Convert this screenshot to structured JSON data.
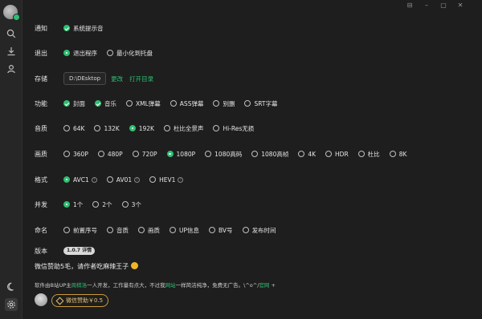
{
  "window": {
    "controls": [
      "⊟",
      "–",
      "▢",
      "✕"
    ]
  },
  "sidebar": {
    "icons": [
      "search-icon",
      "download-icon",
      "user-icon",
      "moon-icon",
      "settings-icon"
    ]
  },
  "settings": {
    "notify": {
      "label": "通知",
      "options": [
        {
          "text": "系统提示音",
          "checked": true
        }
      ]
    },
    "exit": {
      "label": "退出",
      "options": [
        {
          "text": "退出程序",
          "checked": true
        },
        {
          "text": "最小化到托盘",
          "checked": false
        }
      ]
    },
    "storage": {
      "label": "存储",
      "path": "D:\\DEsktop",
      "change": "更改",
      "open_dir": "打开目录"
    },
    "features": {
      "label": "功能",
      "options": [
        {
          "text": "封面",
          "checked": true
        },
        {
          "text": "音乐",
          "checked": true
        },
        {
          "text": "XML弹幕",
          "checked": false
        },
        {
          "text": "ASS弹幕",
          "checked": false
        },
        {
          "text": "别删",
          "checked": false
        },
        {
          "text": "SRT字幕",
          "checked": false
        }
      ]
    },
    "audio": {
      "label": "音质",
      "options": [
        {
          "text": "64K",
          "checked": false
        },
        {
          "text": "132K",
          "checked": false
        },
        {
          "text": "192K",
          "checked": true
        },
        {
          "text": "杜比全景声",
          "checked": false
        },
        {
          "text": "Hi-Res无损",
          "checked": false
        }
      ]
    },
    "quality": {
      "label": "画质",
      "options": [
        {
          "text": "360P",
          "checked": false
        },
        {
          "text": "480P",
          "checked": false
        },
        {
          "text": "720P",
          "checked": false
        },
        {
          "text": "1080P",
          "checked": true
        },
        {
          "text": "1080高码",
          "checked": false
        },
        {
          "text": "1080高帧",
          "checked": false
        },
        {
          "text": "4K",
          "checked": false
        },
        {
          "text": "HDR",
          "checked": false
        },
        {
          "text": "杜比",
          "checked": false
        },
        {
          "text": "8K",
          "checked": false
        }
      ]
    },
    "format": {
      "label": "格式",
      "options": [
        {
          "text": "AVC1",
          "checked": true,
          "info": "i"
        },
        {
          "text": "AV01",
          "checked": false,
          "info": "i"
        },
        {
          "text": "HEV1",
          "checked": false,
          "info": "i"
        }
      ]
    },
    "concurrency": {
      "label": "并发",
      "options": [
        {
          "text": "1个",
          "checked": true
        },
        {
          "text": "2个",
          "checked": false
        },
        {
          "text": "3个",
          "checked": false
        }
      ]
    },
    "naming": {
      "label": "命名",
      "options": [
        {
          "text": "前置序号",
          "checked": false
        },
        {
          "text": "音质",
          "checked": false
        },
        {
          "text": "画质",
          "checked": false
        },
        {
          "text": "UP信息",
          "checked": false
        },
        {
          "text": "BV号",
          "checked": false
        },
        {
          "text": "发布时间",
          "checked": false
        }
      ]
    },
    "version": {
      "label": "版本",
      "value": "1.0.7 详情"
    }
  },
  "donate": {
    "title": "微信赞助5毛，请作者吃麻辣王子",
    "desc_prefix": "软件由B站UP主",
    "desc_name": "周棋洛",
    "desc_mid": "一人开发，工作量有点大，不过我",
    "desc_link1": "网站",
    "desc_suffix": "一样简洁纯净，免费无广告。\\^o^/",
    "desc_link2": "官网",
    "desc_end": " +",
    "button": "微信赞助￥0.5"
  },
  "colors": {
    "accent": "#2fbf71",
    "background": "#1e1e1e",
    "sidebar": "#262626",
    "gold": "#e8c57a"
  }
}
